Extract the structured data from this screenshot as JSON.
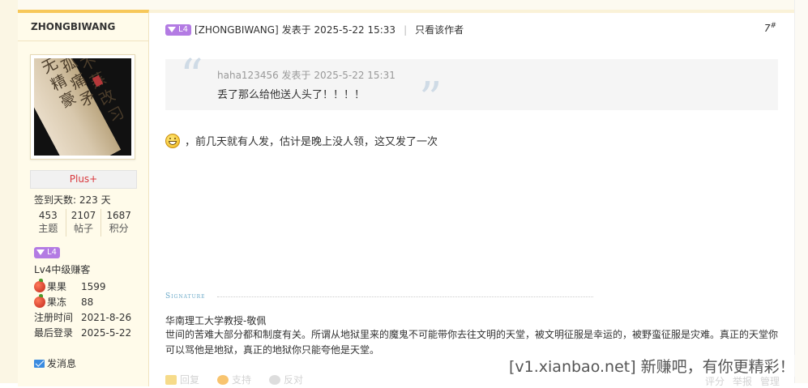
{
  "sidebar": {
    "username": "ZHONGBIWANG",
    "group_badge": "Plus+",
    "sign_days": "签到天数: 223 天",
    "stats": [
      {
        "num": "453",
        "label": "主题"
      },
      {
        "num": "2107",
        "label": "帖子"
      },
      {
        "num": "1687",
        "label": "积分"
      }
    ],
    "level_badge": "L4",
    "level_name": "Lv4中级赚客",
    "fields": [
      {
        "key": "果果",
        "value": "1599"
      },
      {
        "key": "果冻",
        "value": "88"
      },
      {
        "key": "注册时间",
        "value": "2021-8-26"
      },
      {
        "key": "最后登录",
        "value": "2025-5-22"
      }
    ],
    "message_label": "发消息",
    "avatar_chars": [
      "无",
      "精",
      "豪",
      "孤",
      "痛",
      "矛",
      "不",
      "蒸",
      "改",
      "习"
    ]
  },
  "post": {
    "level_badge": "L4",
    "author": "[ZHONGBIWANG]",
    "posted_at": "发表于 2025-5-22 15:33",
    "only_author": "只看该作者",
    "floor": "7",
    "floor_mark": "#",
    "quote": {
      "header": "haha123456 发表于 2025-5-22 15:31",
      "text": "丢了那么给他送人头了！！！！"
    },
    "content": "，前几天就有人发，估计是晚上没人领，这又发了一次",
    "signature_label": "Signature",
    "signature_line1": "华南理工大学教授-敬佩",
    "signature_line2": "世间的苦难大部分都和制度有关。所谓从地狱里来的魔鬼不可能带你去往文明的天堂，被文明征服是幸运的，被野蛮征服是灾难。真正的天堂你可以骂他是地狱，真正的地狱你只能夸他是天堂。",
    "actions": [
      "回复",
      "支持",
      "反对"
    ],
    "right_actions": [
      "评分",
      "举报",
      "管理"
    ]
  },
  "watermark": "[v1.xianbao.net] 新赚吧，有你更精彩！",
  "colors": {
    "sidebar_bg": "#fffbea",
    "accent_top": "#f7c85a",
    "plus_text": "#d9393e",
    "level_badge": "#b37be3",
    "quote_bg": "#f5f5f5",
    "quote_mark": "#cfdbe6",
    "signature_label": "#6aa9c8"
  }
}
